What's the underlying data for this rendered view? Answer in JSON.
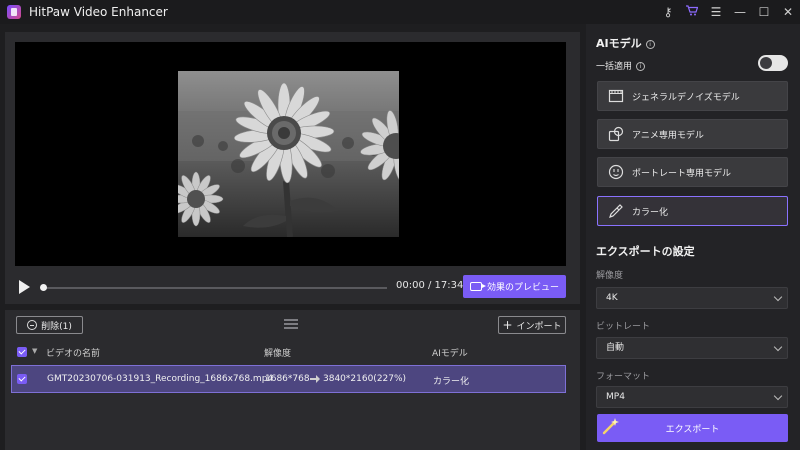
{
  "app": {
    "title": "HitPaw Video Enhancer"
  },
  "window": {
    "key_icon": "key-icon",
    "cart_icon": "cart-icon",
    "menu_icon": "menu-icon",
    "minimize_icon": "minimize-icon",
    "maximize_icon": "maximize-icon",
    "close_icon": "close-icon"
  },
  "player": {
    "time": "00:00 / 17:34",
    "preview_button": "効果のプレビュー"
  },
  "list": {
    "delete_button": "削除(1)",
    "import_button": "インポート",
    "headers": {
      "name": "ビデオの名前",
      "resolution": "解像度",
      "model": "AIモデル"
    },
    "rows": [
      {
        "name": "GMT20230706-031913_Recording_1686x768.mp4",
        "resolution_from": "1686*768",
        "resolution_to": "3840*2160(227%)",
        "model": "カラー化"
      }
    ]
  },
  "sidebar": {
    "ai_model_title": "AIモデル",
    "batch_apply_label": "一括適用",
    "models": [
      {
        "label": "ジェネラルデノイズモデル",
        "icon": "film-icon"
      },
      {
        "label": "アニメ専用モデル",
        "icon": "anime-icon"
      },
      {
        "label": "ポートレート専用モデル",
        "icon": "face-icon"
      },
      {
        "label": "カラー化",
        "icon": "brush-icon",
        "selected": true
      }
    ],
    "export_settings_title": "エクスポートの設定",
    "resolution_label": "解像度",
    "resolution_value": "4K",
    "bitrate_label": "ビットレート",
    "bitrate_value": "自動",
    "format_label": "フォーマット",
    "format_value": "MP4",
    "export_button": "エクスポート"
  },
  "colors": {
    "accent": "#7a5cf5",
    "selected_row": "#4d4680",
    "panel": "#2b2b2e",
    "background": "#1e1e20"
  }
}
